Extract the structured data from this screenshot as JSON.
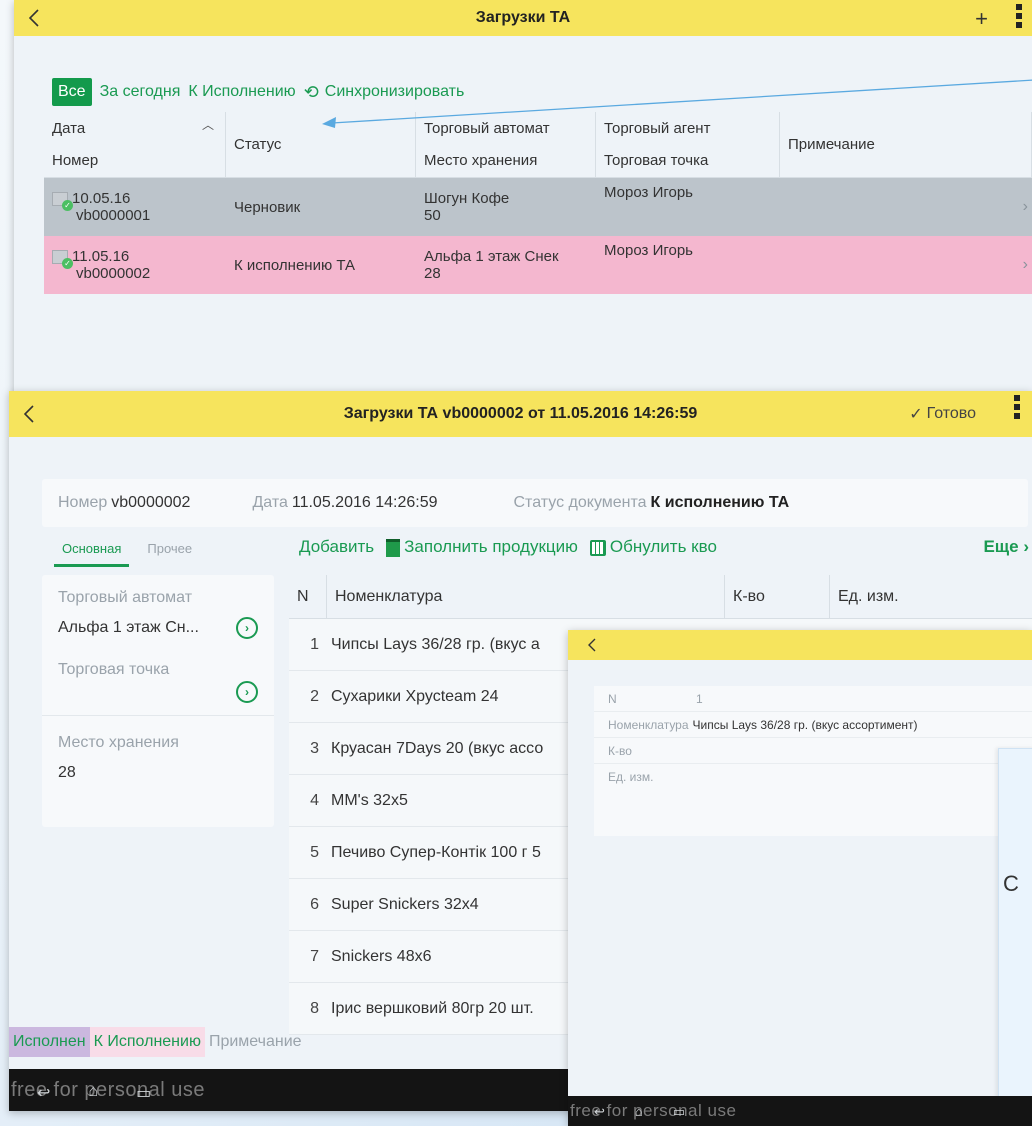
{
  "screen1": {
    "title": "Загрузки ТА",
    "plus": "+",
    "filters": {
      "all": "Все",
      "today": "За сегодня",
      "to_exec": "К Исполнению",
      "sync": "Синхронизировать"
    },
    "columns": {
      "date": "Дата",
      "number": "Номер",
      "status": "Статус",
      "vending": "Торговый автомат",
      "storage": "Место хранения",
      "agent": "Торговый агент",
      "point": "Торговая точка",
      "note": "Примечание"
    },
    "rows": [
      {
        "date": "10.05.16",
        "number": "vb0000001",
        "status": "Черновик",
        "vending": "Шогун Кофе",
        "storage": "50",
        "agent": "Мороз Игорь",
        "color": "#bcc4cb"
      },
      {
        "date": "11.05.16",
        "number": "vb0000002",
        "status": "К исполнению ТА",
        "vending": "Альфа 1 этаж Снек",
        "storage": "28",
        "agent": "Мороз Игорь",
        "color": "#f4b7cf"
      }
    ]
  },
  "screen2": {
    "title": "Загрузки ТА vb0000002 от 11.05.2016 14:26:59",
    "done": "Готово",
    "header": {
      "number_label": "Номер",
      "number": "vb0000002",
      "date_label": "Дата",
      "date": "11.05.2016 14:26:59",
      "status_label": "Статус документа",
      "status": "К исполнению ТА"
    },
    "tabs": {
      "main": "Основная",
      "other": "Прочее"
    },
    "left": {
      "vending_label": "Торговый автомат",
      "vending": "Альфа 1 этаж Сн...",
      "point_label": "Торговая точка",
      "storage_label": "Место хранения",
      "storage": "28"
    },
    "toolbar": {
      "add": "Добавить",
      "fill": "Заполнить продукцию",
      "zero": "Обнулить кво",
      "more": "Еще"
    },
    "columns": {
      "n": "N",
      "name": "Номенклатура",
      "qty": "К-во",
      "unit": "Ед. изм."
    },
    "items": [
      {
        "n": "1",
        "name": "Чипсы Lays 36/28 гр. (вкус а"
      },
      {
        "n": "2",
        "name": "Сухарики Хрусteam 24"
      },
      {
        "n": "3",
        "name": "Круасан 7Days 20 (вкус ассо"
      },
      {
        "n": "4",
        "name": "MM's 32x5"
      },
      {
        "n": "5",
        "name": "Печиво Супер-Контік 100 г 5"
      },
      {
        "n": "6",
        "name": "Super Snickers 32x4"
      },
      {
        "n": "7",
        "name": "Snickers 48x6"
      },
      {
        "n": "8",
        "name": "Ірис вершковий 80гр 20 шт."
      }
    ],
    "legend": {
      "done": "Исполнен",
      "exec": "К Исполнению",
      "note": "Примечание"
    },
    "watermark": "free for personal use"
  },
  "screen3": {
    "fields": {
      "n_label": "N",
      "n": "1",
      "name_label": "Номенклатура",
      "name": "Чипсы Lays 36/28 гр. (вкус ассортимент)",
      "qty_label": "К-во",
      "unit_label": "Ед. изм."
    },
    "dialog_char": "С",
    "watermark": "free for personal use"
  },
  "colors": {
    "accent": "#1a9a52",
    "topbar": "#f6e45d",
    "row_draft": "#bcc4cb",
    "row_exec": "#f4b7cf"
  },
  "icons": [
    "back-icon",
    "plus-icon",
    "kebab-icon",
    "sync-icon",
    "document-check-icon",
    "chevron-right-icon",
    "checkmark-icon",
    "fill-icon",
    "zero-icon",
    "circle-arrow-icon"
  ]
}
